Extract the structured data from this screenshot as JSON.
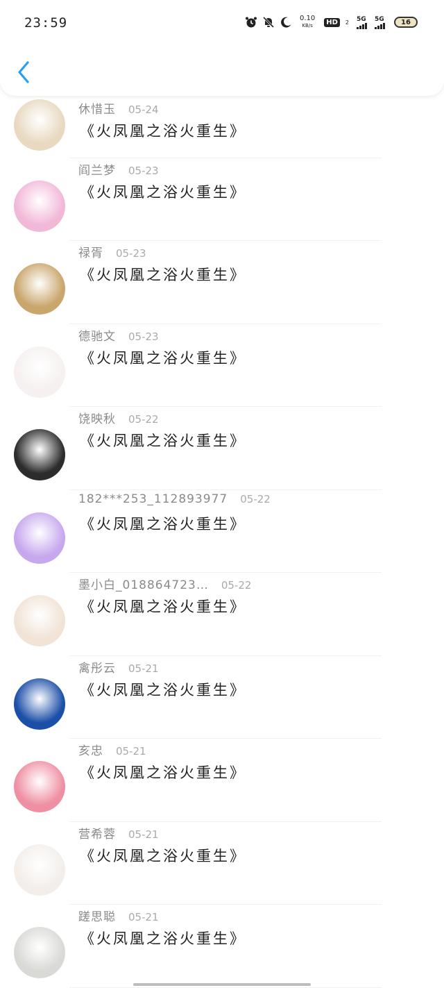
{
  "status": {
    "time": "23:59",
    "speed_value": "0.10",
    "speed_unit": "KB/s",
    "hd_label": "HD",
    "hd_sub": "2",
    "net1": "5G",
    "net2": "5G",
    "battery": "16"
  },
  "header": {
    "back_icon": "chevron-left-icon",
    "accent": "#2a9df4"
  },
  "comments": [
    {
      "name": "休惜玉",
      "date": "05-24",
      "text": "《火凤凰之浴火重生》",
      "avatar_color": "#e8d9c0"
    },
    {
      "name": "阎兰梦",
      "date": "05-23",
      "text": "《火凤凰之浴火重生》",
      "avatar_color": "#f2b8d8"
    },
    {
      "name": "禄胥",
      "date": "05-23",
      "text": "《火凤凰之浴火重生》",
      "avatar_color": "#c9a66b"
    },
    {
      "name": "德驰文",
      "date": "05-23",
      "text": "《火凤凰之浴火重生》",
      "avatar_color": "#f6f0f0"
    },
    {
      "name": "饶映秋",
      "date": "05-22",
      "text": "《火凤凰之浴火重生》",
      "avatar_color": "#2c2c2c"
    },
    {
      "name": "182***253_112893977",
      "date": "05-22",
      "text": "《火凤凰之浴火重生》",
      "avatar_color": "#c7a8ee"
    },
    {
      "name": "墨小白_018864723…",
      "date": "05-22",
      "text": "《火凤凰之浴火重生》",
      "avatar_color": "#f1e3d6"
    },
    {
      "name": "禽彤云",
      "date": "05-21",
      "text": "《火凤凰之浴火重生》",
      "avatar_color": "#1c4fa8"
    },
    {
      "name": "亥忠",
      "date": "05-21",
      "text": "《火凤凰之浴火重生》",
      "avatar_color": "#ef8fa3"
    },
    {
      "name": "营希蓉",
      "date": "05-21",
      "text": "《火凤凰之浴火重生》",
      "avatar_color": "#f3eeea"
    },
    {
      "name": "蹉思聪",
      "date": "05-21",
      "text": "《火凤凰之浴火重生》",
      "avatar_color": "#d9d9d6"
    }
  ]
}
